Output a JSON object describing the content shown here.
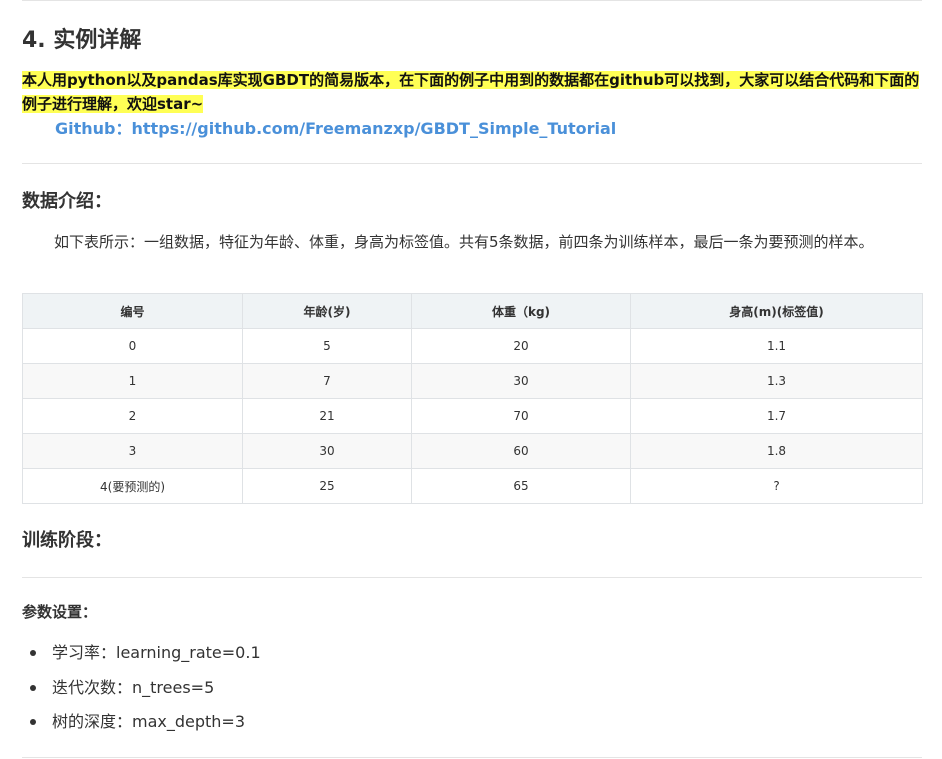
{
  "section_title": "4. 实例详解",
  "intro_text": "本人用python以及pandas库实现GBDT的简易版本，在下面的例子中用到的数据都在github可以找到，大家可以结合代码和下面的例子进行理解，欢迎star~",
  "github_link": "Github：https://github.com/Freemanzxp/GBDT_Simple_Tutorial",
  "data_intro_title": "数据介绍：",
  "data_intro_text": "如下表所示：一组数据，特征为年龄、体重，身高为标签值。共有5条数据，前四条为训练样本，最后一条为要预测的样本。",
  "table": {
    "headers": [
      "编号",
      "年龄(岁)",
      "体重（kg)",
      "身高(m)(标签值)"
    ],
    "rows": [
      [
        "0",
        "5",
        "20",
        "1.1"
      ],
      [
        "1",
        "7",
        "30",
        "1.3"
      ],
      [
        "2",
        "21",
        "70",
        "1.7"
      ],
      [
        "3",
        "30",
        "60",
        "1.8"
      ],
      [
        "4(要预测的)",
        "25",
        "65",
        "?"
      ]
    ]
  },
  "training_title": "训练阶段：",
  "params_title": "参数设置：",
  "params": [
    "学习率：learning_rate=0.1",
    "迭代次数：n_trees=5",
    "树的深度：max_depth=3"
  ],
  "colors": {
    "highlight": "#ffff55",
    "link": "#4a90d9",
    "table_header_bg": "#eff3f5",
    "divider": "#e4e4e4"
  }
}
